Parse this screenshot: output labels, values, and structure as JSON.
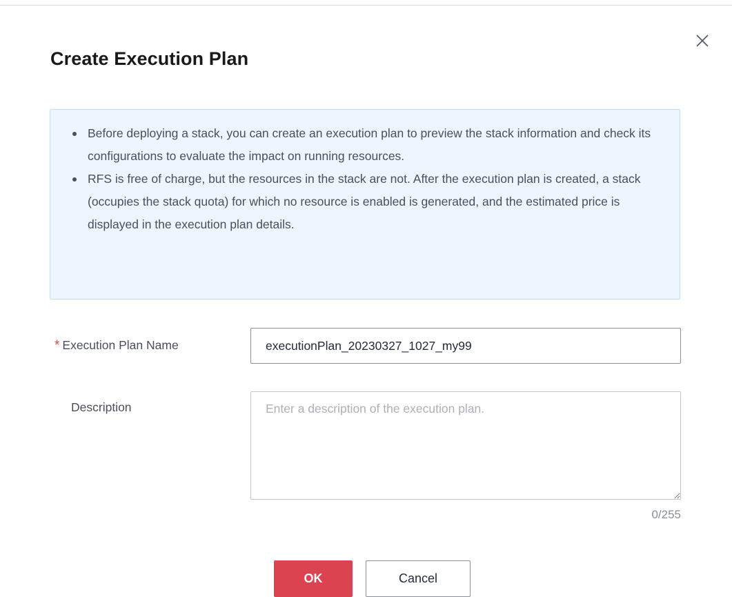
{
  "dialog": {
    "title": "Create Execution Plan",
    "close_icon": "close-icon"
  },
  "info": {
    "items": [
      "Before deploying a stack, you can create an execution plan to preview the stack information and check its configurations to evaluate the impact on running resources.",
      "RFS is free of charge, but the resources in the stack are not. After the execution plan is created, a stack (occupies the stack quota) for which no resource is enabled is generated, and the estimated price is displayed in the execution plan details."
    ]
  },
  "form": {
    "name": {
      "required_mark": "*",
      "label": "Execution Plan Name",
      "value": "executionPlan_20230327_1027_my99"
    },
    "description": {
      "label": "Description",
      "placeholder": "Enter a description of the execution plan.",
      "value": "",
      "counter": "0/255"
    }
  },
  "actions": {
    "ok_label": "OK",
    "cancel_label": "Cancel"
  },
  "colors": {
    "primary_button": "#db4351",
    "info_background": "#edf5ff",
    "info_border": "#c6ddf9",
    "required": "#e54545"
  }
}
